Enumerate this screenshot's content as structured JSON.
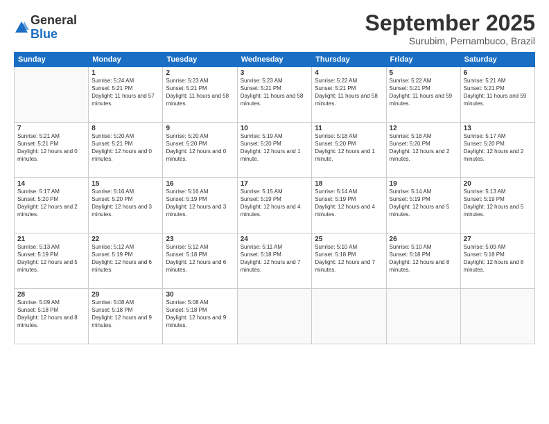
{
  "header": {
    "logo_general": "General",
    "logo_blue": "Blue",
    "month_title": "September 2025",
    "location": "Surubim, Pernambuco, Brazil"
  },
  "days_of_week": [
    "Sunday",
    "Monday",
    "Tuesday",
    "Wednesday",
    "Thursday",
    "Friday",
    "Saturday"
  ],
  "weeks": [
    [
      {
        "day": "",
        "empty": true
      },
      {
        "day": "1",
        "sunrise": "5:24 AM",
        "sunset": "5:21 PM",
        "daylight": "11 hours and 57 minutes."
      },
      {
        "day": "2",
        "sunrise": "5:23 AM",
        "sunset": "5:21 PM",
        "daylight": "11 hours and 58 minutes."
      },
      {
        "day": "3",
        "sunrise": "5:23 AM",
        "sunset": "5:21 PM",
        "daylight": "11 hours and 58 minutes."
      },
      {
        "day": "4",
        "sunrise": "5:22 AM",
        "sunset": "5:21 PM",
        "daylight": "11 hours and 58 minutes."
      },
      {
        "day": "5",
        "sunrise": "5:22 AM",
        "sunset": "5:21 PM",
        "daylight": "11 hours and 59 minutes."
      },
      {
        "day": "6",
        "sunrise": "5:21 AM",
        "sunset": "5:21 PM",
        "daylight": "11 hours and 59 minutes."
      }
    ],
    [
      {
        "day": "7",
        "sunrise": "5:21 AM",
        "sunset": "5:21 PM",
        "daylight": "12 hours and 0 minutes."
      },
      {
        "day": "8",
        "sunrise": "5:20 AM",
        "sunset": "5:21 PM",
        "daylight": "12 hours and 0 minutes."
      },
      {
        "day": "9",
        "sunrise": "5:20 AM",
        "sunset": "5:20 PM",
        "daylight": "12 hours and 0 minutes."
      },
      {
        "day": "10",
        "sunrise": "5:19 AM",
        "sunset": "5:20 PM",
        "daylight": "12 hours and 1 minute."
      },
      {
        "day": "11",
        "sunrise": "5:18 AM",
        "sunset": "5:20 PM",
        "daylight": "12 hours and 1 minute."
      },
      {
        "day": "12",
        "sunrise": "5:18 AM",
        "sunset": "5:20 PM",
        "daylight": "12 hours and 2 minutes."
      },
      {
        "day": "13",
        "sunrise": "5:17 AM",
        "sunset": "5:20 PM",
        "daylight": "12 hours and 2 minutes."
      }
    ],
    [
      {
        "day": "14",
        "sunrise": "5:17 AM",
        "sunset": "5:20 PM",
        "daylight": "12 hours and 2 minutes."
      },
      {
        "day": "15",
        "sunrise": "5:16 AM",
        "sunset": "5:20 PM",
        "daylight": "12 hours and 3 minutes."
      },
      {
        "day": "16",
        "sunrise": "5:16 AM",
        "sunset": "5:19 PM",
        "daylight": "12 hours and 3 minutes."
      },
      {
        "day": "17",
        "sunrise": "5:15 AM",
        "sunset": "5:19 PM",
        "daylight": "12 hours and 4 minutes."
      },
      {
        "day": "18",
        "sunrise": "5:14 AM",
        "sunset": "5:19 PM",
        "daylight": "12 hours and 4 minutes."
      },
      {
        "day": "19",
        "sunrise": "5:14 AM",
        "sunset": "5:19 PM",
        "daylight": "12 hours and 5 minutes."
      },
      {
        "day": "20",
        "sunrise": "5:13 AM",
        "sunset": "5:19 PM",
        "daylight": "12 hours and 5 minutes."
      }
    ],
    [
      {
        "day": "21",
        "sunrise": "5:13 AM",
        "sunset": "5:19 PM",
        "daylight": "12 hours and 5 minutes."
      },
      {
        "day": "22",
        "sunrise": "5:12 AM",
        "sunset": "5:19 PM",
        "daylight": "12 hours and 6 minutes."
      },
      {
        "day": "23",
        "sunrise": "5:12 AM",
        "sunset": "5:18 PM",
        "daylight": "12 hours and 6 minutes."
      },
      {
        "day": "24",
        "sunrise": "5:11 AM",
        "sunset": "5:18 PM",
        "daylight": "12 hours and 7 minutes."
      },
      {
        "day": "25",
        "sunrise": "5:10 AM",
        "sunset": "5:18 PM",
        "daylight": "12 hours and 7 minutes."
      },
      {
        "day": "26",
        "sunrise": "5:10 AM",
        "sunset": "5:18 PM",
        "daylight": "12 hours and 8 minutes."
      },
      {
        "day": "27",
        "sunrise": "5:09 AM",
        "sunset": "5:18 PM",
        "daylight": "12 hours and 8 minutes."
      }
    ],
    [
      {
        "day": "28",
        "sunrise": "5:09 AM",
        "sunset": "5:18 PM",
        "daylight": "12 hours and 8 minutes."
      },
      {
        "day": "29",
        "sunrise": "5:08 AM",
        "sunset": "5:18 PM",
        "daylight": "12 hours and 9 minutes."
      },
      {
        "day": "30",
        "sunrise": "5:08 AM",
        "sunset": "5:18 PM",
        "daylight": "12 hours and 9 minutes."
      },
      {
        "day": "",
        "empty": true
      },
      {
        "day": "",
        "empty": true
      },
      {
        "day": "",
        "empty": true
      },
      {
        "day": "",
        "empty": true
      }
    ]
  ],
  "labels": {
    "sunrise": "Sunrise:",
    "sunset": "Sunset:",
    "daylight": "Daylight:"
  }
}
